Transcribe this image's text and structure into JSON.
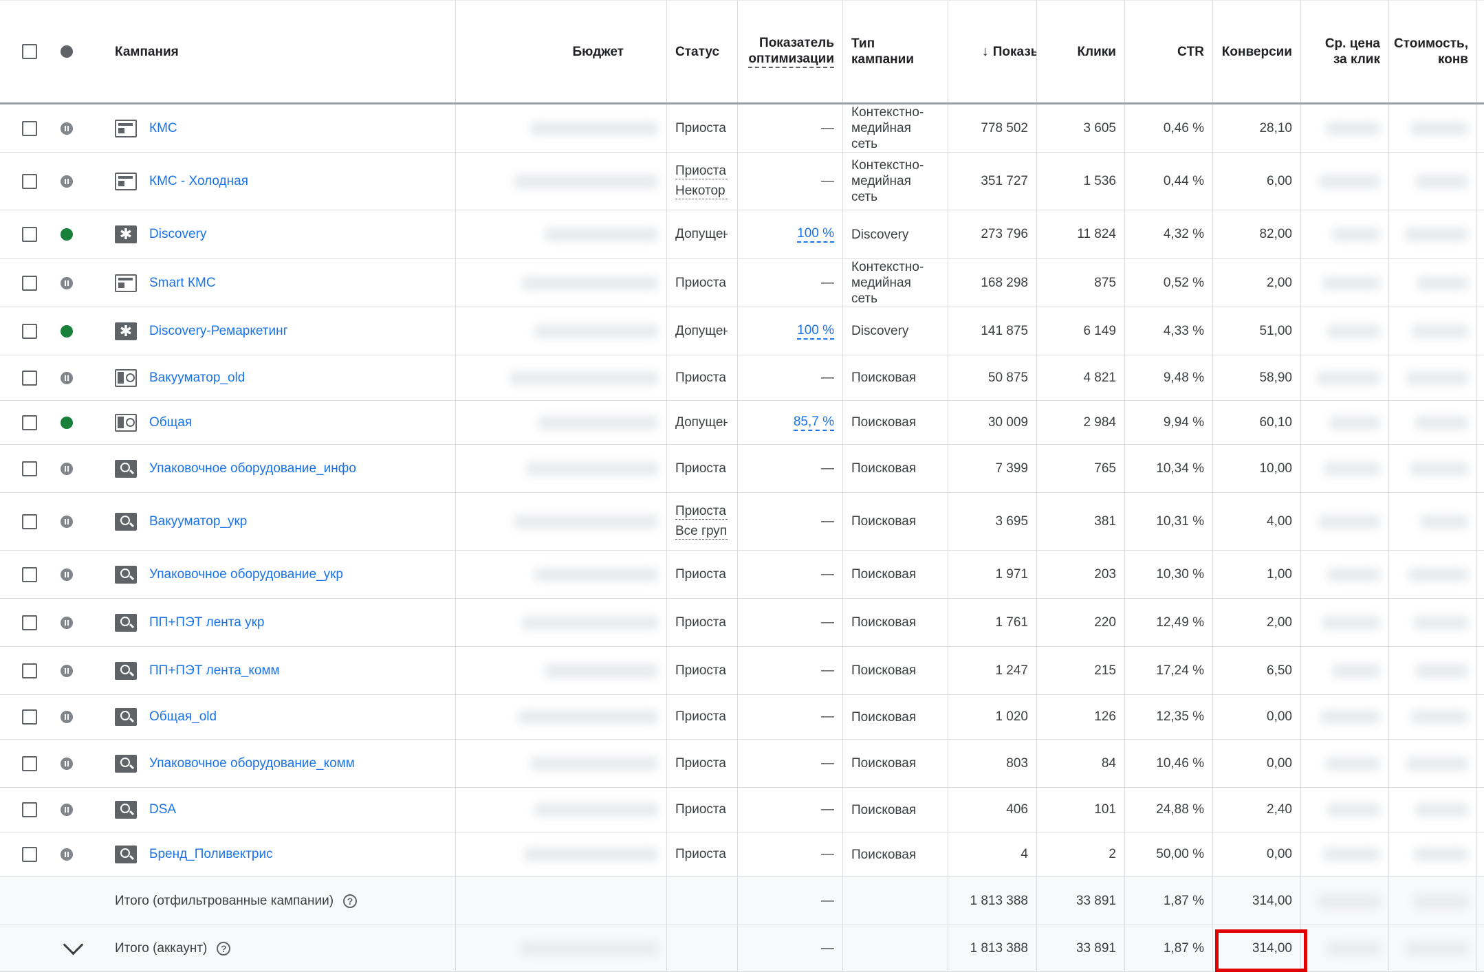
{
  "columns": {
    "campaign": "Кампания",
    "budget": "Бюджет",
    "status": "Статус",
    "optim_line1": "Показатель",
    "optim_line2": "оптимизации",
    "type_line1": "Тип",
    "type_line2": "кампании",
    "impressions": "Показы",
    "sort_icon": "↓",
    "clicks": "Клики",
    "ctr": "CTR",
    "conversions": "Конверсии",
    "cpc_line1": "Ср. цена",
    "cpc_line2": "за клик",
    "cost_line1": "Стоимость,",
    "cost_line2": "конв"
  },
  "rows": [
    {
      "name": "КМС",
      "icon": "display-icon",
      "state": "paused",
      "status": [
        "Приоста"
      ],
      "optim": "—",
      "type": [
        "Контекстно-",
        "медийная",
        "сеть"
      ],
      "impressions": "778 502",
      "clicks": "3 605",
      "ctr": "0,46 %",
      "conversions": "28,10"
    },
    {
      "name": "КМС - Холодная",
      "icon": "display-icon",
      "state": "paused",
      "status": [
        "Приоста",
        "Некотор"
      ],
      "optim": "—",
      "type": [
        "Контекстно-",
        "медийная",
        "сеть"
      ],
      "impressions": "351 727",
      "clicks": "1 536",
      "ctr": "0,44 %",
      "conversions": "6,00"
    },
    {
      "name": "Discovery",
      "icon": "discovery-icon",
      "state": "enabled",
      "status": [
        "Допущен"
      ],
      "optim": "100 %",
      "type": [
        "Discovery"
      ],
      "impressions": "273 796",
      "clicks": "11 824",
      "ctr": "4,32 %",
      "conversions": "82,00"
    },
    {
      "name": "Smart КМС",
      "icon": "display-icon",
      "state": "paused",
      "status": [
        "Приоста"
      ],
      "optim": "—",
      "type": [
        "Контекстно-",
        "медийная",
        "сеть"
      ],
      "impressions": "168 298",
      "clicks": "875",
      "ctr": "0,52 %",
      "conversions": "2,00"
    },
    {
      "name": "Discovery-Ремаркетинг",
      "icon": "discovery-icon",
      "state": "enabled",
      "status": [
        "Допущен"
      ],
      "optim": "100 %",
      "type": [
        "Discovery"
      ],
      "impressions": "141 875",
      "clicks": "6 149",
      "ctr": "4,33 %",
      "conversions": "51,00"
    },
    {
      "name": "Вакууматор_old",
      "icon": "search-display-icon",
      "state": "paused",
      "status": [
        "Приоста"
      ],
      "optim": "—",
      "type": [
        "Поисковая"
      ],
      "impressions": "50 875",
      "clicks": "4 821",
      "ctr": "9,48 %",
      "conversions": "58,90"
    },
    {
      "name": "Общая",
      "icon": "search-display-icon",
      "state": "enabled",
      "status": [
        "Допущен"
      ],
      "optim": "85,7 %",
      "type": [
        "Поисковая"
      ],
      "impressions": "30 009",
      "clicks": "2 984",
      "ctr": "9,94 %",
      "conversions": "60,10"
    },
    {
      "name": "Упаковочное оборудование_инфо",
      "icon": "search-icon",
      "state": "paused",
      "status": [
        "Приоста"
      ],
      "optim": "—",
      "type": [
        "Поисковая"
      ],
      "impressions": "7 399",
      "clicks": "765",
      "ctr": "10,34 %",
      "conversions": "10,00"
    },
    {
      "name": "Вакууматор_укр",
      "icon": "search-icon",
      "state": "paused",
      "status": [
        "Приоста",
        "Все груп"
      ],
      "optim": "—",
      "type": [
        "Поисковая"
      ],
      "impressions": "3 695",
      "clicks": "381",
      "ctr": "10,31 %",
      "conversions": "4,00"
    },
    {
      "name": "Упаковочное оборудование_укр",
      "icon": "search-icon",
      "state": "paused",
      "status": [
        "Приоста"
      ],
      "optim": "—",
      "type": [
        "Поисковая"
      ],
      "impressions": "1 971",
      "clicks": "203",
      "ctr": "10,30 %",
      "conversions": "1,00"
    },
    {
      "name": "ПП+ПЭТ лента укр",
      "icon": "search-icon",
      "state": "paused",
      "status": [
        "Приоста"
      ],
      "optim": "—",
      "type": [
        "Поисковая"
      ],
      "impressions": "1 761",
      "clicks": "220",
      "ctr": "12,49 %",
      "conversions": "2,00"
    },
    {
      "name": "ПП+ПЭТ лента_комм",
      "icon": "search-icon",
      "state": "paused",
      "status": [
        "Приоста"
      ],
      "optim": "—",
      "type": [
        "Поисковая"
      ],
      "impressions": "1 247",
      "clicks": "215",
      "ctr": "17,24 %",
      "conversions": "6,50"
    },
    {
      "name": "Общая_old",
      "icon": "search-icon",
      "state": "paused",
      "status": [
        "Приоста"
      ],
      "optim": "—",
      "type": [
        "Поисковая"
      ],
      "impressions": "1 020",
      "clicks": "126",
      "ctr": "12,35 %",
      "conversions": "0,00"
    },
    {
      "name": "Упаковочное оборудование_комм",
      "icon": "search-icon",
      "state": "paused",
      "status": [
        "Приоста"
      ],
      "optim": "—",
      "type": [
        "Поисковая"
      ],
      "impressions": "803",
      "clicks": "84",
      "ctr": "10,46 %",
      "conversions": "0,00"
    },
    {
      "name": "DSA",
      "icon": "search-icon",
      "state": "paused",
      "status": [
        "Приоста"
      ],
      "optim": "—",
      "type": [
        "Поисковая"
      ],
      "impressions": "406",
      "clicks": "101",
      "ctr": "24,88 %",
      "conversions": "2,40"
    },
    {
      "name": "Бренд_Поливектрис",
      "icon": "search-icon",
      "state": "paused",
      "status": [
        "Приоста"
      ],
      "optim": "—",
      "type": [
        "Поисковая"
      ],
      "impressions": "4",
      "clicks": "2",
      "ctr": "50,00 %",
      "conversions": "0,00"
    }
  ],
  "totals": [
    {
      "label": "Итого (отфильтрованные кампании)",
      "optim": "—",
      "impressions": "1 813 388",
      "clicks": "33 891",
      "ctr": "1,87 %",
      "conversions": "314,00",
      "expandable": false
    },
    {
      "label": "Итого (аккаунт)",
      "optim": "—",
      "impressions": "1 813 388",
      "clicks": "33 891",
      "ctr": "1,87 %",
      "conversions": "314,00",
      "expandable": true
    }
  ],
  "help_glyph": "?",
  "colors": {
    "link": "#1a73e8",
    "enabled": "#188038",
    "paused": "#80868b",
    "highlight": "#e00000"
  }
}
